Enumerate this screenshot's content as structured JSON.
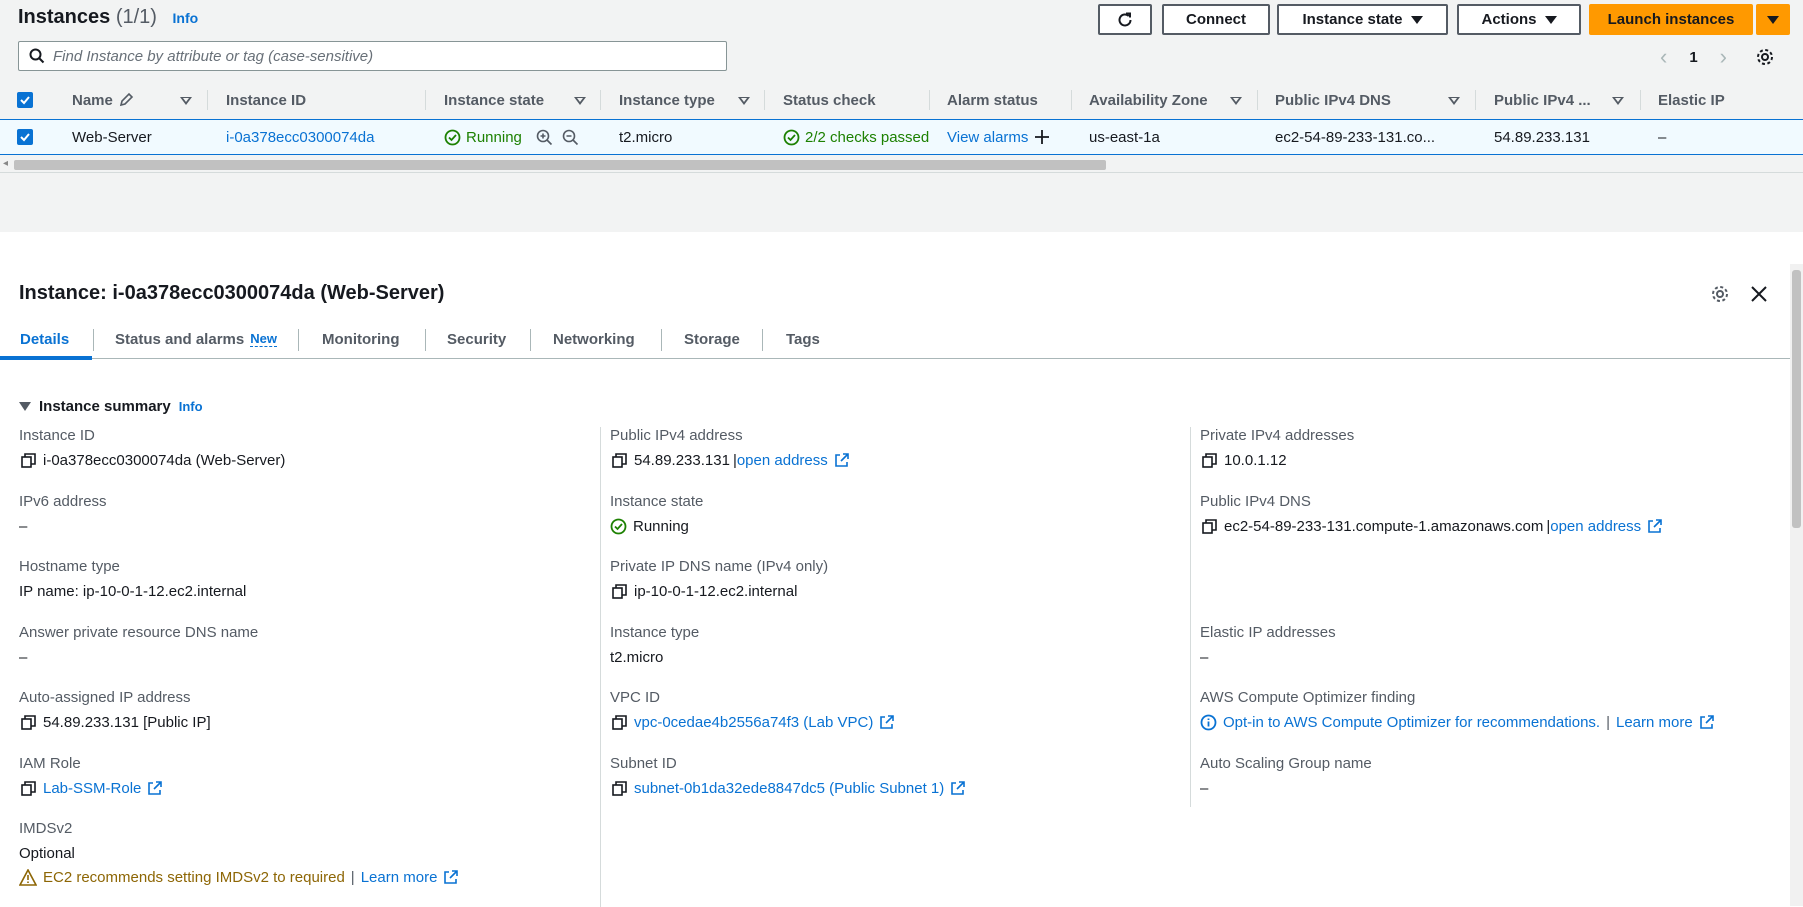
{
  "header": {
    "title": "Instances",
    "count": "(1/1)",
    "info": "Info",
    "buttons": {
      "connect": "Connect",
      "instance_state": "Instance state",
      "actions": "Actions",
      "launch": "Launch instances"
    },
    "search_placeholder": "Find Instance by attribute or tag (case-sensitive)",
    "page_number": "1"
  },
  "table": {
    "columns": [
      "Name",
      "Instance ID",
      "Instance state",
      "Instance type",
      "Status check",
      "Alarm status",
      "Availability Zone",
      "Public IPv4 DNS",
      "Public IPv4 ...",
      "Elastic IP"
    ],
    "row": {
      "name": "Web-Server",
      "instance_id": "i-0a378ecc0300074da",
      "state": "Running",
      "type": "t2.micro",
      "status_check": "2/2 checks passed",
      "alarm": "View alarms",
      "az": "us-east-1a",
      "dns": "ec2-54-89-233-131.co...",
      "ipv4": "54.89.233.131",
      "elastic_ip": "–"
    }
  },
  "panel": {
    "title": "Instance: i-0a378ecc0300074da (Web-Server)",
    "tabs": [
      "Details",
      "Status and alarms",
      "Monitoring",
      "Security",
      "Networking",
      "Storage",
      "Tags"
    ],
    "new_badge": "New",
    "summary_title": "Instance summary",
    "summary_info": "Info",
    "col1": {
      "instance_id_label": "Instance ID",
      "instance_id_value": "i-0a378ecc0300074da (Web-Server)",
      "ipv6_label": "IPv6 address",
      "ipv6_value": "–",
      "hostname_label": "Hostname type",
      "hostname_value": "IP name: ip-10-0-1-12.ec2.internal",
      "answer_dns_label": "Answer private resource DNS name",
      "answer_dns_value": "–",
      "auto_ip_label": "Auto-assigned IP address",
      "auto_ip_value": "54.89.233.131 [Public IP]",
      "iam_label": "IAM Role",
      "iam_value": "Lab-SSM-Role",
      "imds_label": "IMDSv2",
      "imds_value": "Optional",
      "imds_warning": "EC2 recommends setting IMDSv2 to required",
      "imds_learn": "Learn more"
    },
    "col2": {
      "public_ip_label": "Public IPv4 address",
      "public_ip_value": "54.89.233.131",
      "open_address": "open address",
      "state_label": "Instance state",
      "state_value": "Running",
      "private_dns_label": "Private IP DNS name (IPv4 only)",
      "private_dns_value": "ip-10-0-1-12.ec2.internal",
      "type_label": "Instance type",
      "type_value": "t2.micro",
      "vpc_label": "VPC ID",
      "vpc_value": "vpc-0cedae4b2556a74f3 (Lab VPC)",
      "subnet_label": "Subnet ID",
      "subnet_value": "subnet-0b1da32ede8847dc5 (Public Subnet 1)"
    },
    "col3": {
      "private_ip_label": "Private IPv4 addresses",
      "private_ip_value": "10.0.1.12",
      "public_dns_label": "Public IPv4 DNS",
      "public_dns_value": "ec2-54-89-233-131.compute-1.amazonaws.com",
      "open_address": "open address",
      "elastic_label": "Elastic IP addresses",
      "elastic_value": "–",
      "optimizer_label": "AWS Compute Optimizer finding",
      "optimizer_value": "Opt-in to AWS Compute Optimizer for recommendations.",
      "optimizer_learn": "Learn more",
      "asg_label": "Auto Scaling Group name",
      "asg_value": "–"
    }
  },
  "colors": {
    "accent": "#0972d3",
    "launch": "#ff9900",
    "success": "#1d8102",
    "warning": "#8d6605"
  }
}
